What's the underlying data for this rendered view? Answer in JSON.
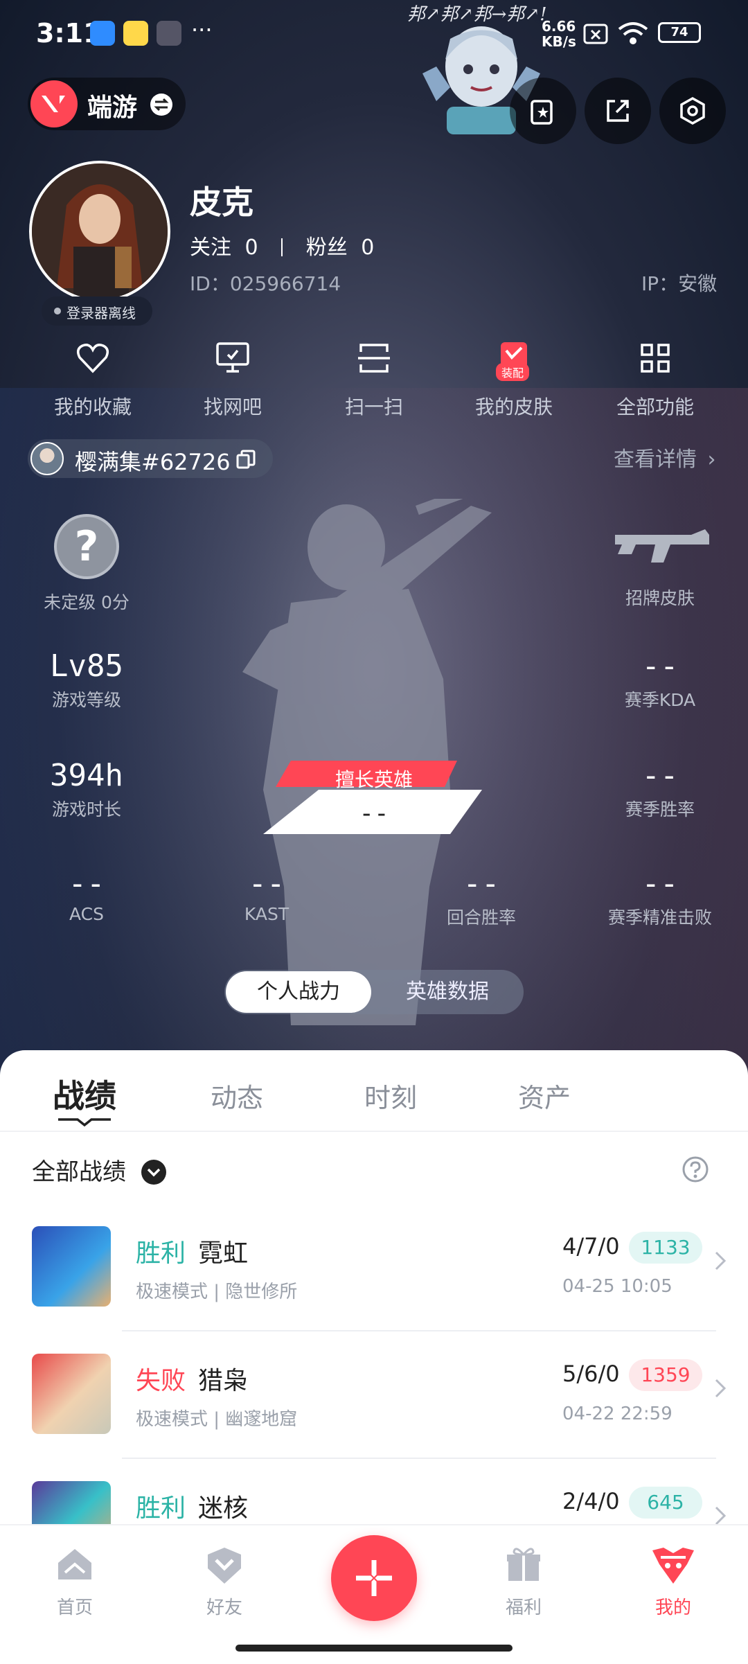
{
  "status_bar": {
    "time": "3:11",
    "more": "···",
    "speed_value": "6.66",
    "speed_unit": "KB/s",
    "battery": "74",
    "sticker_text": "邦↗邦↗邦→邦↗!"
  },
  "header": {
    "mode_label": "端游",
    "icons": [
      "card-icon",
      "share-icon",
      "settings-icon"
    ]
  },
  "profile": {
    "name": "皮克",
    "follow_label": "关注",
    "follow_count": "0",
    "fans_label": "粉丝",
    "fans_count": "0",
    "id_text": "ID：025966714",
    "ip_text": "IP：安徽",
    "status": "登录器离线"
  },
  "quick_actions": [
    {
      "label": "我的收藏",
      "icon": "heart-icon"
    },
    {
      "label": "找网吧",
      "icon": "monitor-icon"
    },
    {
      "label": "扫一扫",
      "icon": "scan-icon"
    },
    {
      "label": "我的皮肤",
      "icon": "skin-icon",
      "badge": "装配"
    },
    {
      "label": "全部功能",
      "icon": "grid-icon"
    }
  ],
  "game_account": {
    "tag": "樱满集#62726",
    "details_link": "查看详情"
  },
  "stats": {
    "rank_label": "未定级 0分",
    "rank_icon_text": "?",
    "skin_label": "招牌皮肤",
    "level_value": "Lv85",
    "level_label": "游戏等级",
    "kda_value": "--",
    "kda_label": "赛季KDA",
    "time_value": "394h",
    "time_label": "游戏时长",
    "winrate_value": "--",
    "winrate_label": "赛季胜率",
    "fav_hero_label": "擅长英雄",
    "fav_hero_value": "--",
    "acs_value": "--",
    "acs_label": "ACS",
    "kast_value": "--",
    "kast_label": "KAST",
    "round_value": "--",
    "round_label": "回合胜率",
    "precision_value": "--",
    "precision_label": "赛季精准击败"
  },
  "toggle": {
    "active": "个人战力",
    "inactive": "英雄数据"
  },
  "tabs": [
    "战绩",
    "动态",
    "时刻",
    "资产"
  ],
  "filter": {
    "label": "全部战绩"
  },
  "matches": [
    {
      "result": "胜利",
      "hero": "霓虹",
      "mode": "极速模式 | 隐世修所",
      "kda": "4/7/0",
      "score": "1133",
      "date": "04-25 10:05",
      "win": true
    },
    {
      "result": "失败",
      "hero": "猎枭",
      "mode": "极速模式 | 幽邃地窟",
      "kda": "5/6/0",
      "score": "1359",
      "date": "04-22 22:59",
      "win": false
    },
    {
      "result": "胜利",
      "hero": "迷核",
      "mode": "",
      "kda": "2/4/0",
      "score": "645",
      "date": "",
      "win": true
    }
  ],
  "bottom_nav": [
    {
      "label": "首页",
      "icon": "home-icon"
    },
    {
      "label": "好友",
      "icon": "friends-icon"
    },
    {
      "label": "福利",
      "icon": "gift-icon"
    },
    {
      "label": "我的",
      "icon": "me-icon"
    }
  ],
  "colors": {
    "accent": "#ff4655",
    "win": "#2cb3a6",
    "lose": "#ff4655",
    "win_badge_bg": "#e3f6f4",
    "lose_badge_bg": "#fde8ea"
  }
}
